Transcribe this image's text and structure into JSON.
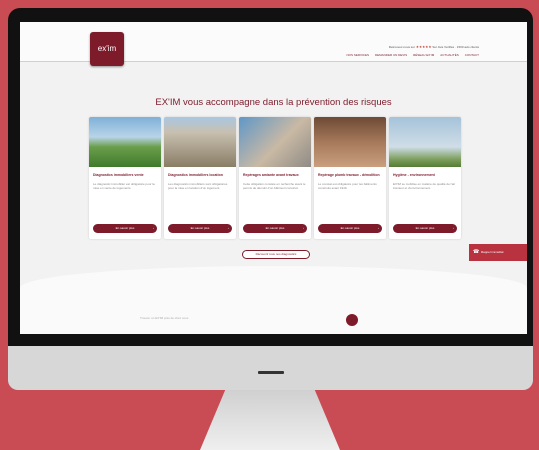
{
  "header": {
    "logo_text": "ex'im",
    "top_info": "Retrouvez-nous sur",
    "rating_stars": "★★★★★",
    "rating_text": "Sur Avis Vérifiés · 1500 avis clients",
    "nav": [
      "NOS SERVICES",
      "DEMANDER UN DEVIS",
      "RÉSEAU EX'IM",
      "ACTUALITÉS",
      "CONTACT"
    ]
  },
  "main": {
    "title": "EX'IM vous accompagne dans la prévention des risques",
    "cards": [
      {
        "title": "Diagnostics immobiliers vente",
        "text": "Le diagnostic immobilier est obligatoire pour la mise en vente de logements.",
        "button": "En savoir plus"
      },
      {
        "title": "Diagnostics immobiliers location",
        "text": "Les diagnostics immobiliers sont obligatoires pour la mise en location d'un logement.",
        "button": "En savoir plus"
      },
      {
        "title": "Repérages amiante avant travaux",
        "text": "Cette obligation consiste en recherche avant le permis de démolir d'un bâtiment construit.",
        "button": "En savoir plus"
      },
      {
        "title": "Repérage plomb travaux - démolition",
        "text": "Le constat est obligatoire pour les bâtiments construits avant 1949.",
        "button": "En savoir plus"
      },
      {
        "title": "Hygiène - environnement",
        "text": "EX'IM se mobilise en matière de qualité de l'air intérieur et d'environnement.",
        "button": "En savoir plus"
      }
    ],
    "discover_button": "Découvrir tous nos diagnostics"
  },
  "callback_button": "Rappel immédiat",
  "lower_text": "Trouver un EX'IM près de chez vous"
}
